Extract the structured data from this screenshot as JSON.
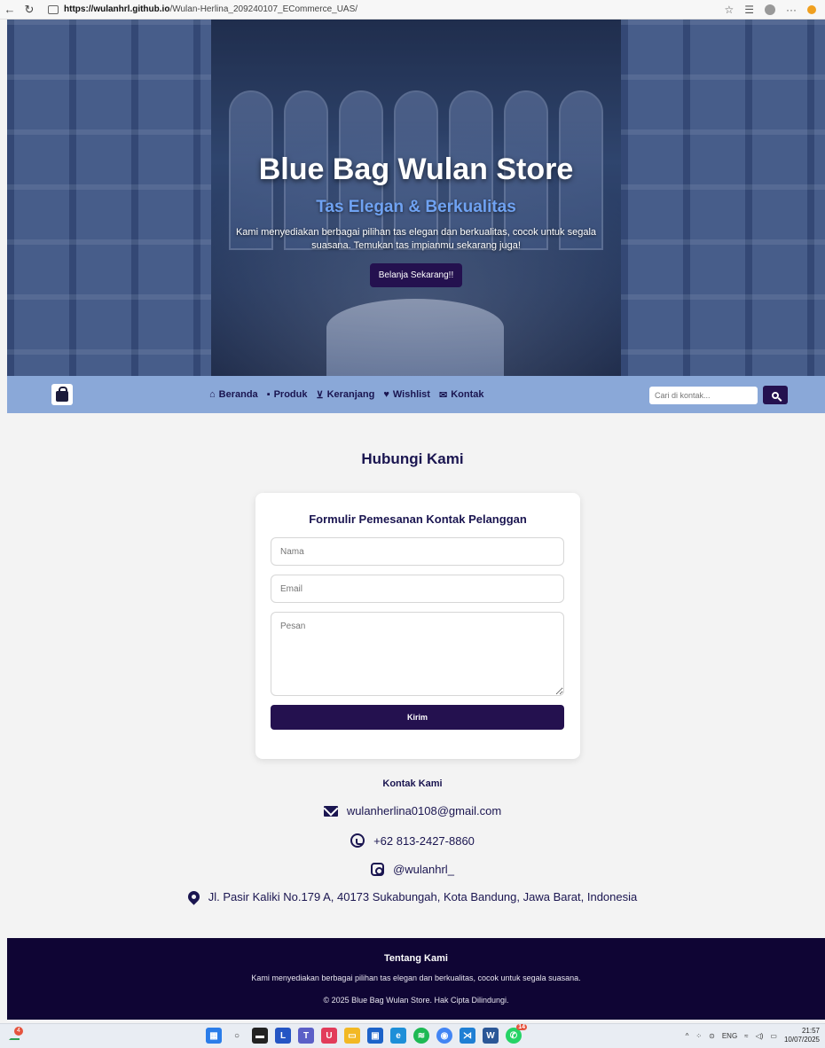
{
  "browser": {
    "url_host": "https://wulanhrl.github.io",
    "url_path": "/Wulan-Herlina_209240107_ECommerce_UAS/"
  },
  "hero": {
    "title": "Blue Bag Wulan Store",
    "subtitle": "Tas Elegan & Berkualitas",
    "description": "Kami menyediakan berbagai pilihan tas elegan dan berkualitas, cocok untuk segala suasana. Temukan tas impianmu sekarang juga!",
    "cta_label": "Belanja Sekarang!!"
  },
  "navbar": {
    "links": [
      {
        "label": "Beranda",
        "icon": "home-icon"
      },
      {
        "label": "Produk",
        "icon": "shopping-bag-icon"
      },
      {
        "label": "Keranjang",
        "icon": "cart-icon"
      },
      {
        "label": "Wishlist",
        "icon": "heart-icon"
      },
      {
        "label": "Kontak",
        "icon": "envelope-icon"
      }
    ],
    "search_placeholder": "Cari di kontak..."
  },
  "contact_section": {
    "title": "Hubungi Kami",
    "form": {
      "title": "Formulir Pemesanan Kontak Pelanggan",
      "name_placeholder": "Nama",
      "email_placeholder": "Email",
      "message_placeholder": "Pesan",
      "submit_label": "Kirim"
    },
    "info": {
      "title": "Kontak Kami",
      "email": "wulanherlina0108@gmail.com",
      "phone": "+62 813-2427-8860",
      "instagram": "@wulanhrl_",
      "address": "Jl. Pasir Kaliki No.179 A, 40173 Sukabungah, Kota Bandung, Jawa Barat, Indonesia"
    }
  },
  "footer": {
    "title": "Tentang Kami",
    "description": "Kami menyediakan berbagai pilihan tas elegan dan berkualitas, cocok untuk segala suasana.",
    "copyright": "© 2025 Blue Bag Wulan Store. Hak Cipta Dilindungi."
  },
  "taskbar": {
    "weather_badge": "4",
    "language": "ENG",
    "time": "21:57",
    "date": "10/07/2025",
    "whatsapp_badge": "14"
  },
  "colors": {
    "primary": "#24114f",
    "navbar": "#8aa8d8",
    "footer": "#0f0534",
    "hero_subtitle": "#6fa2f2"
  }
}
